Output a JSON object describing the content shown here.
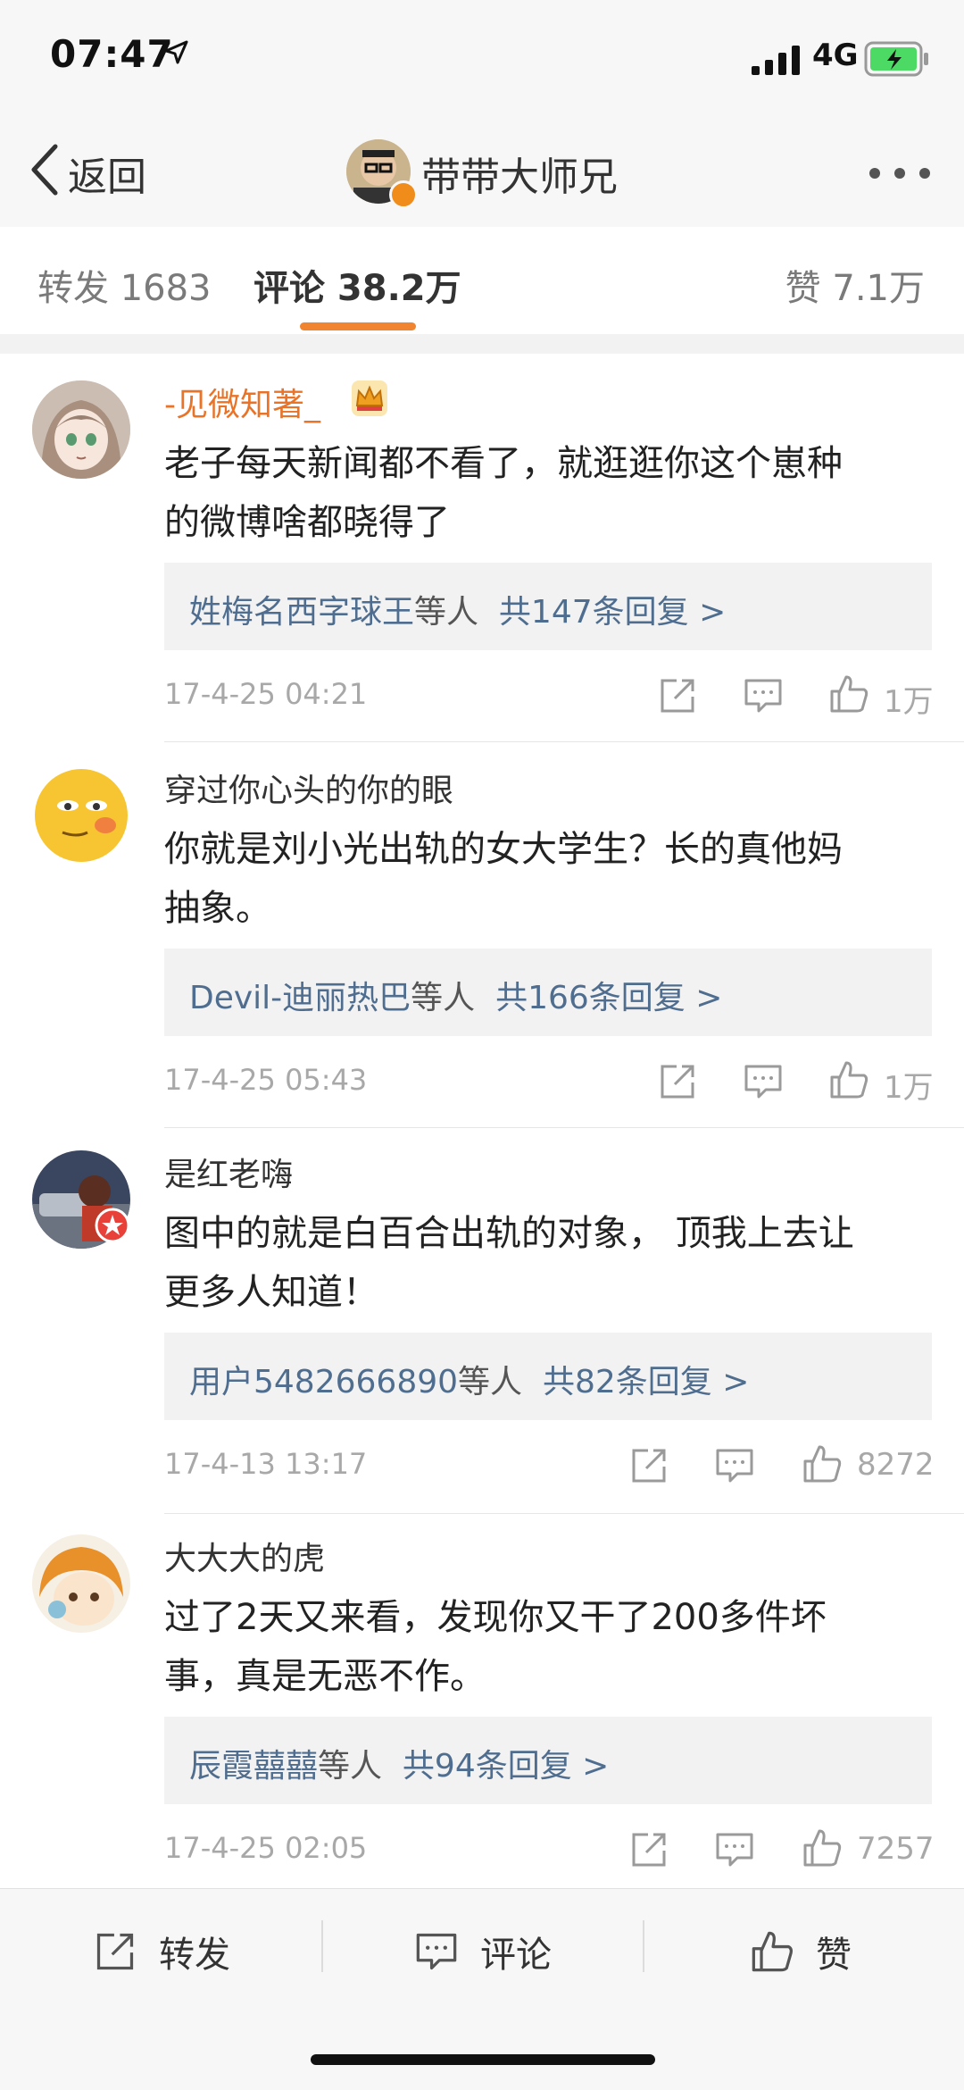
{
  "status_bar": {
    "time": "07:47",
    "network": "4G",
    "battery_color": "#4cd964"
  },
  "nav": {
    "back_label": "返回",
    "title": "带带大师兄",
    "badge_color": "#f08c1a"
  },
  "tabs": {
    "repost": "转发 1683",
    "comment": "评论 38.2万",
    "like": "赞 7.1万",
    "accent": "#f08430"
  },
  "comments": [
    {
      "username": "-见微知著_",
      "username_color": "#e8742a",
      "text_line1": "老子每天新闻都不看了，就逛逛你这个崽种",
      "text_line2": "的微博啥都晓得了",
      "reply_names": "姓梅名西字球王",
      "reply_mid": "等人",
      "reply_count": "共147条回复 >",
      "time": "17-4-25 04:21",
      "likes": "1万"
    },
    {
      "username": "穿过你心头的你的眼",
      "username_color": "#333333",
      "text_line1": "你就是刘小光出轨的女大学生？长的真他妈",
      "text_line2": "抽象。",
      "reply_names": "Devil-迪丽热巴",
      "reply_mid": "等人",
      "reply_count": "共166条回复 >",
      "time": "17-4-25 05:43",
      "likes": "1万"
    },
    {
      "username": "是红老嗨",
      "username_color": "#333333",
      "text_line1": "图中的就是白百合出轨的对象， 顶我上去让",
      "text_line2": "更多人知道！",
      "reply_names": "用户5482666890",
      "reply_mid": "等人",
      "reply_count": "共82条回复 >",
      "time": "17-4-13 13:17",
      "likes": "8272"
    },
    {
      "username": "大大大的虎",
      "username_color": "#333333",
      "text_line1": "过了2天又来看，发现你又干了200多件坏",
      "text_line2": "事，真是无恶不作。",
      "reply_names": "辰霞囍囍",
      "reply_mid": "等人",
      "reply_count": "共94条回复 >",
      "time": "17-4-25 02:05",
      "likes": "7257"
    }
  ],
  "bottom_bar": {
    "repost": "转发",
    "comment": "评论",
    "like": "赞"
  }
}
